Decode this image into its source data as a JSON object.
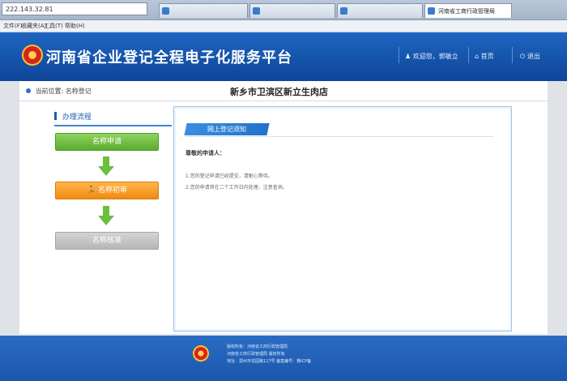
{
  "browser": {
    "address": "222.143.32.81",
    "tabs": [
      {
        "label": ""
      },
      {
        "label": ""
      },
      {
        "label": ""
      },
      {
        "label": "河南省工商行政管理局"
      }
    ],
    "menu": [
      "文件(F)",
      "收藏夹(A)",
      "工具(T)",
      "帮助(H)"
    ]
  },
  "header": {
    "title": "河南省企业登记全程电子化服务平台",
    "welcome": "欢迎您，郭敏立",
    "home": "首页",
    "logout": "退出"
  },
  "breadcrumb": {
    "prefix": "当前位置:",
    "current": "名称登记"
  },
  "shop_name": "新乡市卫滨区新立生肉店",
  "steps": {
    "heading": "办理流程",
    "items": [
      {
        "label": "名称申请",
        "state": "done"
      },
      {
        "label": "名称初审",
        "state": "current"
      },
      {
        "label": "名称核准",
        "state": "pending"
      }
    ]
  },
  "notice": {
    "tag": "网上登记须知",
    "greeting": "尊敬的申请人：",
    "lines": [
      "1.您的登记申请已经提交，请耐心等待。",
      "2.您的申请将在二个工作日内处理，注意查询。"
    ]
  },
  "footer": {
    "lines": [
      "版权所有：河南省工商行政管理局",
      "河南省工商行政管理局 版权所有",
      "地址：郑州市花园路127号  备案编号：豫ICP备"
    ]
  },
  "colors": {
    "header": "#1452a8",
    "step_done": "#5aab2e",
    "step_current": "#f08a10",
    "step_pending": "#b6b6b6",
    "panel_border": "#9fc4e6"
  }
}
